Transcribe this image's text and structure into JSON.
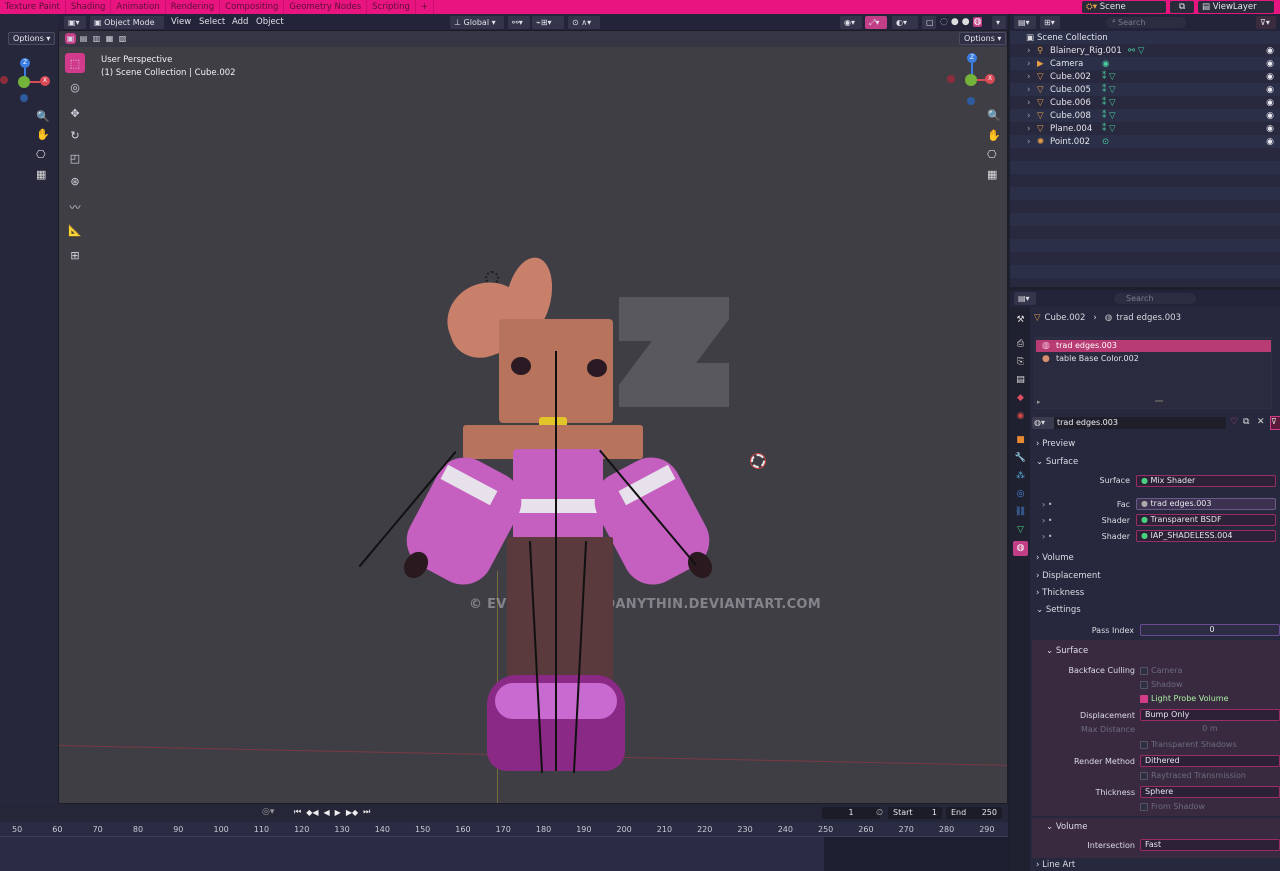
{
  "workspaces": [
    "Texture Paint",
    "Shading",
    "Animation",
    "Rendering",
    "Compositing",
    "Geometry Nodes",
    "Scripting"
  ],
  "workspace_add": "+",
  "scene_name": "Scene",
  "view_layer": "ViewLayer",
  "viewport": {
    "mode": "Object Mode",
    "menus": [
      "View",
      "Select",
      "Add",
      "Object"
    ],
    "orientation": "Global",
    "options_label": "Options",
    "perspective": "User Perspective",
    "collection_info": "(1) Scene Collection | Cube.002",
    "watermark": "© EVERYTHINGANDANYTHIN.DEVIANTART.COM",
    "gizmo_axes": [
      "Z",
      "Y",
      "X"
    ]
  },
  "timeline": {
    "current_frame": "1",
    "start_label": "Start",
    "start_value": "1",
    "end_label": "End",
    "end_value": "250",
    "ticks": [
      "50",
      "60",
      "70",
      "80",
      "90",
      "100",
      "110",
      "120",
      "130",
      "140",
      "150",
      "160",
      "170",
      "180",
      "190",
      "200",
      "210",
      "220",
      "230",
      "240",
      "250",
      "260",
      "270",
      "280",
      "290"
    ]
  },
  "outliner": {
    "search_placeholder": "Search",
    "root": "Scene Collection",
    "items": [
      {
        "name": "Blainery_Rig.001",
        "icon": "armature-icon",
        "color": "#e8a04a"
      },
      {
        "name": "Camera",
        "icon": "camera-icon",
        "color": "#e8a04a"
      },
      {
        "name": "Cube.002",
        "icon": "mesh-icon",
        "color": "#e8a04a"
      },
      {
        "name": "Cube.005",
        "icon": "mesh-icon",
        "color": "#e8a04a"
      },
      {
        "name": "Cube.006",
        "icon": "mesh-icon",
        "color": "#e8a04a"
      },
      {
        "name": "Cube.008",
        "icon": "mesh-icon",
        "color": "#e8a04a"
      },
      {
        "name": "Plane.004",
        "icon": "mesh-icon",
        "color": "#e8a04a"
      },
      {
        "name": "Point.002",
        "icon": "light-icon",
        "color": "#e8a04a"
      }
    ]
  },
  "properties": {
    "search_placeholder": "Search",
    "breadcrumb_object": "Cube.002",
    "breadcrumb_material": "trad edges.003",
    "slots": [
      "trad edges.003",
      "table Base Color.002"
    ],
    "material_name": "trad edges.003",
    "sections": {
      "preview": "Preview",
      "surface": "Surface",
      "volume": "Volume",
      "displacement": "Displacement",
      "thickness": "Thickness",
      "settings": "Settings",
      "line_art": "Line Art"
    },
    "surface_rows": [
      {
        "label": "Surface",
        "value": "Mix Shader"
      },
      {
        "label": "Fac",
        "value": "trad edges.003"
      },
      {
        "label": "Shader",
        "value": "Transparent BSDF"
      },
      {
        "label": "Shader",
        "value": "IAP_SHADELESS.004"
      }
    ],
    "settings": {
      "pass_index_label": "Pass Index",
      "pass_index": "0",
      "surface_sub": "Surface",
      "backface_label": "Backface Culling",
      "camera": "Camera",
      "shadow": "Shadow",
      "light_probe": "Light Probe Volume",
      "displacement_label": "Displacement",
      "displacement_value": "Bump Only",
      "max_distance_label": "Max Distance",
      "max_distance_value": "0 m",
      "transparent_shadows": "Transparent Shadows",
      "render_method_label": "Render Method",
      "render_method_value": "Dithered",
      "raytraced": "Raytraced Transmission",
      "thickness_label": "Thickness",
      "thickness_value": "Sphere",
      "from_shadow": "From Shadow",
      "volume_sub": "Volume",
      "intersection_label": "Intersection",
      "intersection_value": "Fast"
    }
  },
  "colors": {
    "accent": "#e8147f",
    "active_tool": "#d23b8c",
    "field_border": "#9b2d65",
    "viewport_bg": "#403e45"
  }
}
